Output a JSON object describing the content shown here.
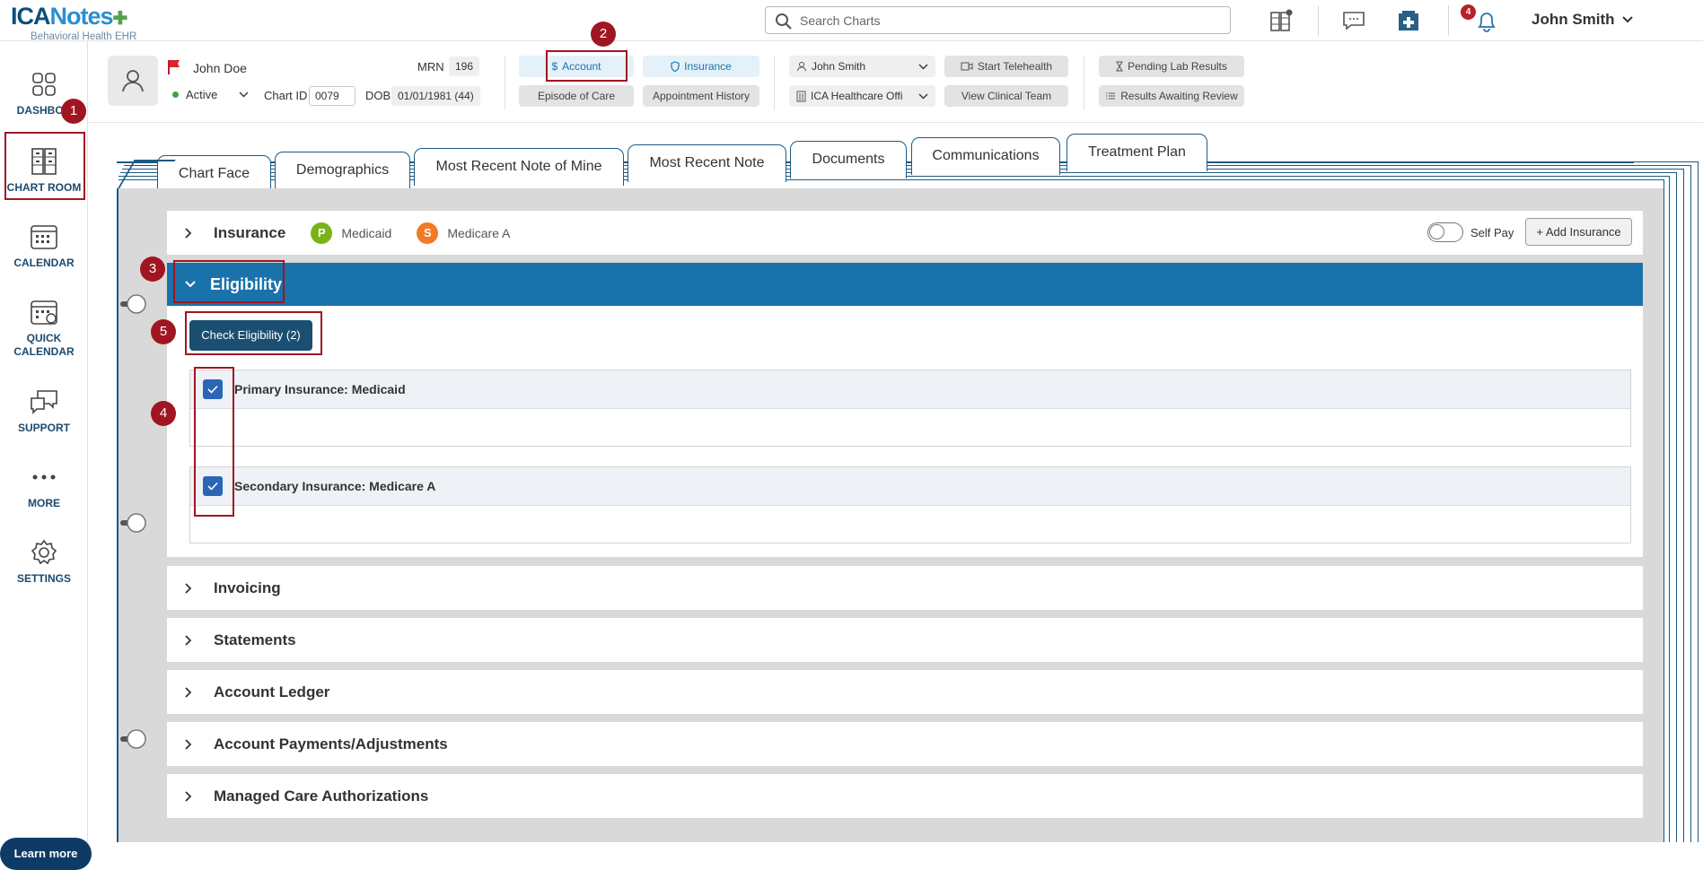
{
  "header": {
    "logo_main_a": "ICA",
    "logo_main_b": "Notes",
    "logo_sub": "Behavioral Health EHR",
    "search_placeholder": "Search Charts",
    "notification_count": "4",
    "user_name": "John Smith"
  },
  "sidebar": {
    "items": [
      {
        "label": "DASHBOA",
        "icon": "dashboard-icon"
      },
      {
        "label": "CHART ROOM",
        "icon": "chart-room-icon"
      },
      {
        "label": "CALENDAR",
        "icon": "calendar-icon"
      },
      {
        "label": "QUICK CALENDAR",
        "icon": "quick-calendar-icon"
      },
      {
        "label": "SUPPORT",
        "icon": "support-icon"
      },
      {
        "label": "MORE",
        "icon": "more-icon"
      },
      {
        "label": "SETTINGS",
        "icon": "settings-icon"
      }
    ],
    "learn_more": "Learn more"
  },
  "patient": {
    "name": "John Doe",
    "status": "Active",
    "mrn_label": "MRN",
    "mrn": "196",
    "chart_id_label": "Chart ID",
    "chart_id": "0079",
    "dob_label": "DOB",
    "dob": "01/01/1981 (44)"
  },
  "actions": {
    "account": "Account",
    "insurance": "Insurance",
    "episode_of_care": "Episode of Care",
    "appointment_history": "Appointment History",
    "provider": "John Smith",
    "location": "ICA Healthcare Offi",
    "start_telehealth": "Start Telehealth",
    "view_clinical_team": "View Clinical Team",
    "pending_lab_results": "Pending Lab Results",
    "results_awaiting_review": "Results Awaiting Review"
  },
  "tabs": [
    "Chart Face",
    "Demographics",
    "Most Recent Note of Mine",
    "Most Recent Note",
    "Documents",
    "Communications",
    "Treatment Plan"
  ],
  "insurance_row": {
    "title": "Insurance",
    "primary_badge": "P",
    "primary_name": "Medicaid",
    "secondary_badge": "S",
    "secondary_name": "Medicare A",
    "self_pay": "Self Pay",
    "add_insurance": "+ Add Insurance"
  },
  "eligibility": {
    "title": "Eligibility",
    "check_button": "Check Eligibility (2)",
    "cards": [
      {
        "label": "Primary Insurance: Medicaid",
        "checked": true
      },
      {
        "label": "Secondary Insurance: Medicare A",
        "checked": true
      }
    ]
  },
  "sections": [
    "Invoicing",
    "Statements",
    "Account Ledger",
    "Account Payments/Adjustments",
    "Managed Care Authorizations"
  ],
  "annotations": [
    "1",
    "2",
    "3",
    "4",
    "5"
  ],
  "colors": {
    "brand_dark": "#0b4f7c",
    "accent_blue": "#1a72ab",
    "annotation_red": "#a01620",
    "primary_badge": "#7ab317",
    "secondary_badge": "#f07a26"
  }
}
